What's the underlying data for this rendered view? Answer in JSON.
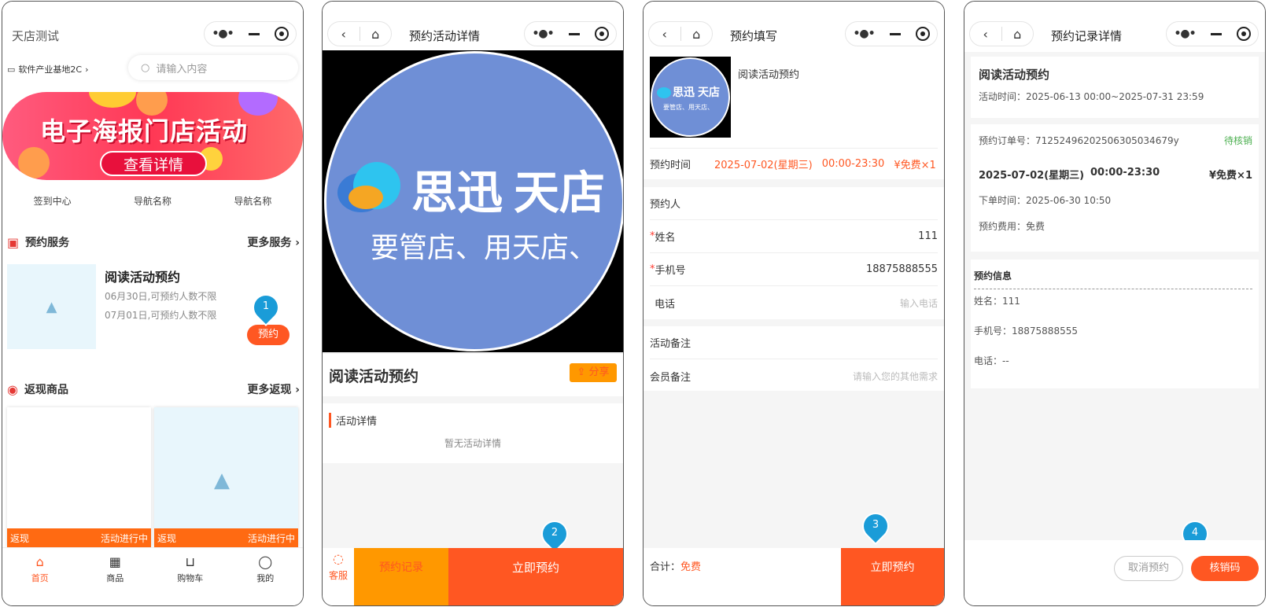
{
  "phone1": {
    "shop_name": "天店测试",
    "location": "软件产业基地2C",
    "search_placeholder": "请输入内容",
    "banner_title": "电子海报门店活动",
    "banner_button": "查看详情",
    "nav": [
      "签到中心",
      "导航名称",
      "导航名称"
    ],
    "booking_section": "预约服务",
    "booking_more": "更多服务",
    "activity": {
      "title": "阅读活动预约",
      "lines": [
        "06月30日,可预约人数不限",
        "07月01日,可预约人数不限"
      ],
      "button": "预约"
    },
    "cashback_section": "返现商品",
    "cashback_more": "更多返现",
    "products": [
      {
        "tag": "返现",
        "status": "活动进行中"
      },
      {
        "tag": "返现",
        "status": "活动进行中"
      }
    ],
    "tabs": [
      "首页",
      "商品",
      "购物车",
      "我的"
    ]
  },
  "phone2": {
    "title": "预约活动详情",
    "brand_name": "思迅",
    "brand_store": "天店",
    "brand_slogan": "要管店、用天店、",
    "activity_title": "阅读活动预约",
    "share": "分享",
    "detail_header": "活动详情",
    "detail_empty": "暂无活动详情",
    "service": "客服",
    "records": "预约记录",
    "book_now": "立即预约"
  },
  "phone3": {
    "title": "预约填写",
    "brand_name": "思迅",
    "brand_store": "天店",
    "brand_slogan": "要管店、用天店、",
    "activity_title": "阅读活动预约",
    "time_label": "预约时间",
    "time_value": "2025-07-02(星期三)",
    "time_range": "00:00-23:30",
    "price": "¥免费×1",
    "person_header": "预约人",
    "name_label": "姓名",
    "name_value": "111",
    "phone_label": "手机号",
    "phone_value": "18875888555",
    "tel_label": "电话",
    "tel_placeholder": "输入电话",
    "note_header": "活动备注",
    "member_note_label": "会员备注",
    "member_note_placeholder": "请输入您的其他需求",
    "total_label": "合计：",
    "total_value": "免费",
    "submit": "立即预约"
  },
  "phone4": {
    "title": "预约记录详情",
    "activity_title": "阅读活动预约",
    "activity_time": "活动时间：2025-06-13 00:00~2025-07-31 23:59",
    "order_no": "预约订单号：7125249620250630503467​9y",
    "status": "待核销",
    "slot_date": "2025-07-02(星期三)",
    "slot_time": "00:00-23:30",
    "slot_price": "¥免费×1",
    "order_time": "下单时间：2025-06-30 10:50",
    "fee": "预约费用：免费",
    "info_header": "预约信息",
    "info_name": "姓名：111",
    "info_phone": "手机号：18875888555",
    "info_tel": "电话：--",
    "cancel": "取消预约",
    "verify": "核销码"
  },
  "markers": [
    "1",
    "2",
    "3",
    "4"
  ],
  "colors": {
    "accent": "#ff5722",
    "orange": "#ff9800",
    "marker": "#1a9cd8",
    "status_green": "#4caf50"
  }
}
